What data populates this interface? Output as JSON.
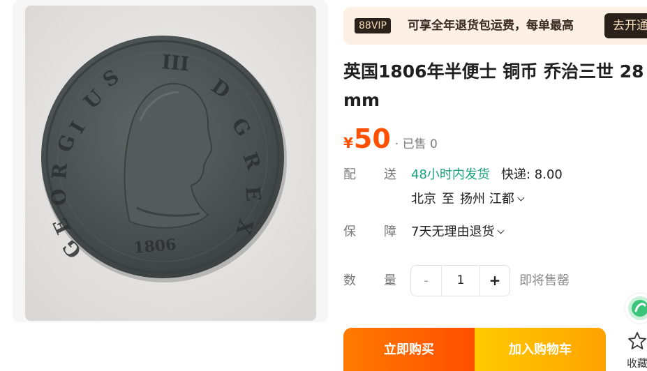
{
  "product": {
    "image_alt": "coin-photo",
    "title_line1": "英国1806年半便士 铜币 乔治三世 28",
    "title_line2": "mm"
  },
  "vip": {
    "badge": "88VIP",
    "text": "可享全年退货包运费，每单最高",
    "open_button": "去开通"
  },
  "price": {
    "currency": "¥",
    "amount": "50",
    "sold": "· 已售 0"
  },
  "shipping": {
    "label_left": "配",
    "label_right": "送",
    "fast": "48小时内发货",
    "fee": "快递: 8.00",
    "from": "北京",
    "to_word": "至",
    "destination": "扬州 江都"
  },
  "guarantee": {
    "label_left": "保",
    "label_right": "障",
    "text": "7天无理由退货"
  },
  "quantity": {
    "label_left": "数",
    "label_right": "量",
    "minus": "-",
    "value": "1",
    "plus": "+",
    "stock_note": "即将售罄"
  },
  "actions": {
    "buy_now": "立即购买",
    "add_cart": "加入购物车",
    "favorite": "收藏"
  },
  "colors": {
    "price": "#ff5000",
    "fast_ship": "#1aa37a",
    "buy_gradient": [
      "#ff7a00",
      "#ff4f00"
    ],
    "cart_gradient": [
      "#ffcb00",
      "#ffa200"
    ]
  },
  "icons": [
    "chevron-down-icon",
    "service-chat-icon",
    "star-icon"
  ]
}
